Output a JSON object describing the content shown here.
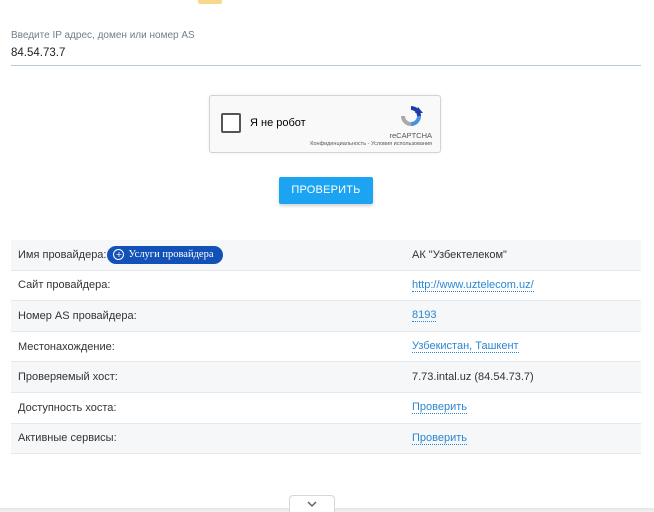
{
  "lookup": {
    "label": "Введите IP адрес, домен или номер AS",
    "value": "84.54.73.7"
  },
  "captcha": {
    "text": "Я не робот",
    "brand": "reCAPTCHA",
    "links": "Конфиденциальность - Условия использования"
  },
  "check_button": "ПРОВЕРИТЬ",
  "provider_services_badge": "Услуги провайдера",
  "info_rows": [
    {
      "label": "Имя провайдера:",
      "value": "АК \"Узбектелеком\""
    },
    {
      "label": "Сайт провайдера:",
      "value": "http://www.uztelecom.uz/"
    },
    {
      "label": "Номер AS провайдера:",
      "value": "8193"
    },
    {
      "label": "Местонахождение:",
      "value": "Узбекистан, Ташкент"
    },
    {
      "label": "Проверяемый хост:",
      "value": "7.73.intal.uz (84.54.73.7)"
    },
    {
      "label": "Доступность хоста:",
      "value": "Проверить"
    },
    {
      "label": "Активные сервисы:",
      "value": "Проверить"
    }
  ],
  "colors": {
    "accent": "#1ca4f2",
    "badge": "#1252b8",
    "link": "#2b86d1"
  }
}
